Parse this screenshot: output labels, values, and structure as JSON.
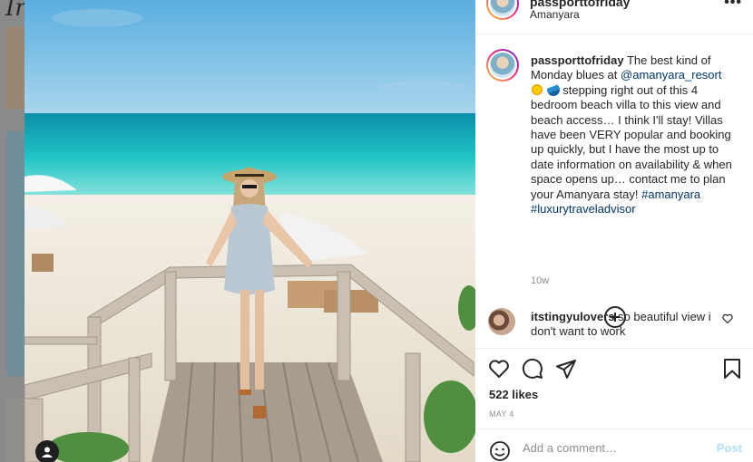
{
  "background": {
    "logo_text": "In"
  },
  "post": {
    "username": "passporttofriday",
    "location": "Amanyara",
    "caption": {
      "username": "passporttofriday",
      "text_1": " The best kind of Monday blues at ",
      "mention": "@amanyara_resort",
      "emoji_1": "sun-emoji",
      "emoji_2": "wave-emoji",
      "text_2": " stepping right out of this 4 bedroom beach villa to this view and beach access… I think I'll stay! Villas have been VERY popular and booking up quickly, but I have the most up to date information on availability & when space opens up… contact me to plan your Amanyara stay! ",
      "hashtag_1": "#amanyara",
      "hashtag_2": "#luxurytraveladvisor"
    },
    "time_ago": "10w",
    "comments": [
      {
        "username": "itstingyulovers",
        "text": " so beautiful view i don't want to work"
      }
    ],
    "likes": "522 likes",
    "date": "MAY 4",
    "add_comment_placeholder": "Add a comment…",
    "post_label": "Post"
  },
  "colors": {
    "link": "#00376b",
    "post_button": "#b2dffc",
    "muted": "#8e8e8e"
  },
  "icons": [
    "more-icon",
    "add-icon",
    "heart-icon",
    "comment-icon",
    "share-icon",
    "bookmark-icon",
    "emoji-icon",
    "user-tag-icon"
  ]
}
